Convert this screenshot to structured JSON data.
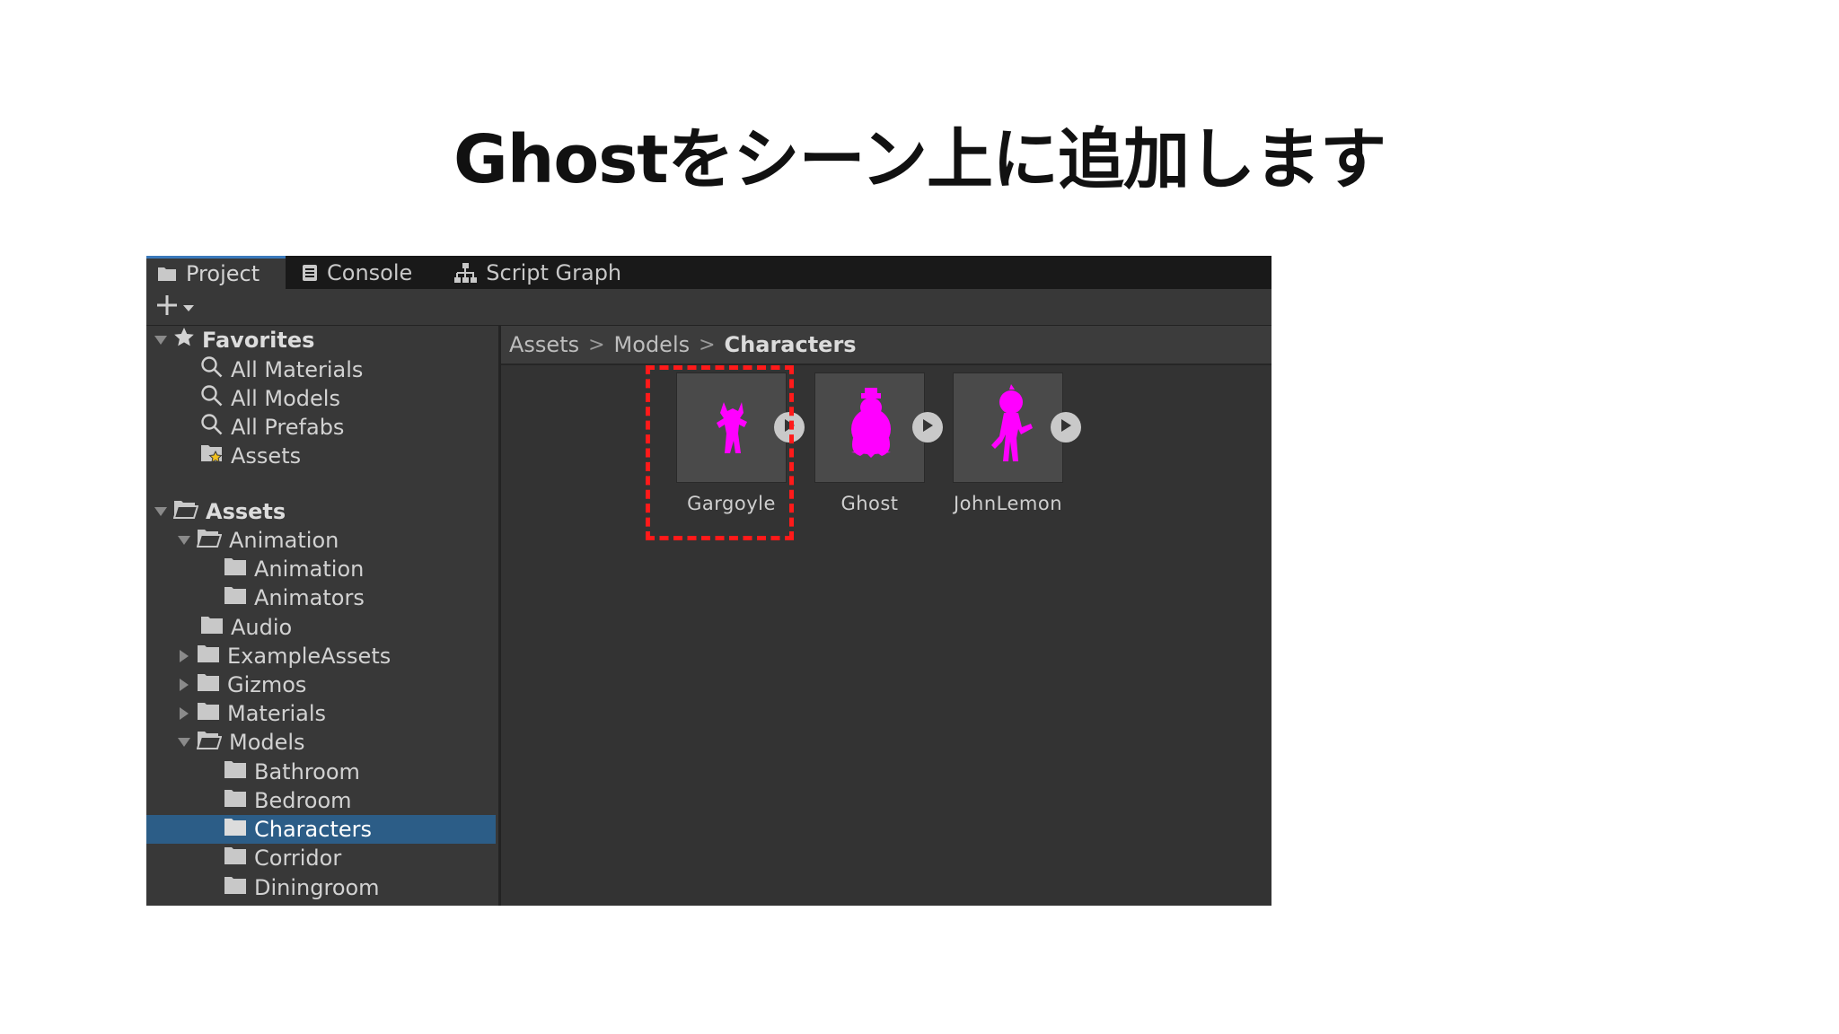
{
  "slide": {
    "title": "Ghostをシーン上に追加します"
  },
  "colors": {
    "highlight": "#ff1a1a",
    "model_preview": "#ff00ff",
    "selection": "#2c5d87"
  },
  "tabs": [
    {
      "label": "Project",
      "icon": "folder-icon",
      "active": true
    },
    {
      "label": "Console",
      "icon": "console-icon",
      "active": false
    },
    {
      "label": "Script Graph",
      "icon": "graph-icon",
      "active": false
    }
  ],
  "toolbar": {
    "add_icon": "plus-icon"
  },
  "sidebar": {
    "favorites": {
      "label": "Favorites",
      "items": [
        "All Materials",
        "All Models",
        "All Prefabs",
        "Assets"
      ]
    },
    "assets": {
      "label": "Assets",
      "tree": [
        "Animation",
        "Animation",
        "Animators",
        "Audio",
        "ExampleAssets",
        "Gizmos",
        "Materials",
        "Models",
        "Bathroom",
        "Bedroom",
        "Characters",
        "Corridor",
        "Diningroom"
      ],
      "selected": "Characters"
    }
  },
  "breadcrumb": [
    "Assets",
    "Models",
    "Characters"
  ],
  "assets_grid": [
    {
      "name": "Gargoyle"
    },
    {
      "name": "Ghost",
      "highlighted": true
    },
    {
      "name": "JohnLemon"
    }
  ]
}
